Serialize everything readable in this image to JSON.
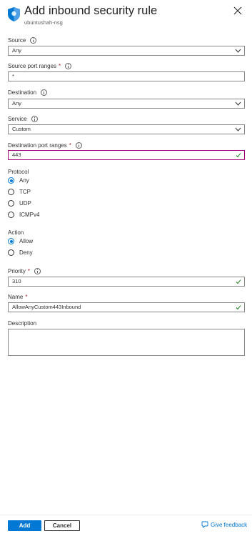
{
  "panel": {
    "title": "Add inbound security rule",
    "subtitle": "ubuntushah-nsg",
    "icons": {
      "shield": "shield-icon",
      "close": "close-icon"
    },
    "accent_color": "#0078d4",
    "focus_color": "#a2007a",
    "success_color": "#107c10"
  },
  "source": {
    "label": "Source",
    "value": "Any"
  },
  "source_port_ranges": {
    "label": "Source port ranges",
    "required_mark": "*",
    "value": "*"
  },
  "destination": {
    "label": "Destination",
    "value": "Any"
  },
  "service": {
    "label": "Service",
    "value": "Custom"
  },
  "destination_port_ranges": {
    "label": "Destination port ranges",
    "required_mark": "*",
    "value": "443"
  },
  "protocol": {
    "label": "Protocol",
    "selected": "Any",
    "options": [
      {
        "label": "Any",
        "selected": true
      },
      {
        "label": "TCP",
        "selected": false
      },
      {
        "label": "UDP",
        "selected": false
      },
      {
        "label": "ICMPv4",
        "selected": false
      }
    ]
  },
  "action": {
    "label": "Action",
    "selected": "Allow",
    "options": [
      {
        "label": "Allow",
        "selected": true
      },
      {
        "label": "Deny",
        "selected": false
      }
    ]
  },
  "priority": {
    "label": "Priority",
    "required_mark": "*",
    "value": "310"
  },
  "name": {
    "label": "Name",
    "required_mark": "*",
    "value": "AllowAnyCustom443Inbound"
  },
  "description": {
    "label": "Description",
    "value": ""
  },
  "footer": {
    "add_label": "Add",
    "cancel_label": "Cancel",
    "feedback_label": "Give feedback"
  }
}
